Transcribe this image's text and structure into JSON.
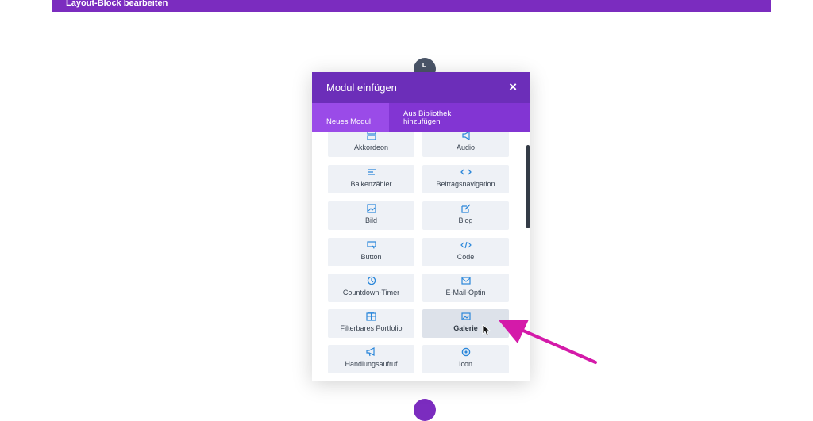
{
  "topbar": {
    "title": "Layout-Block bearbeiten"
  },
  "modal": {
    "title": "Modul einfügen",
    "close_symbol": "×",
    "tabs": {
      "new": "Neues Modul",
      "library_line1": "Aus Bibliothek",
      "library_line2": "hinzufügen"
    },
    "modules": [
      {
        "label": "Akkordeon",
        "icon": "accordion-icon"
      },
      {
        "label": "Audio",
        "icon": "audio-icon"
      },
      {
        "label": "Balkenzähler",
        "icon": "bar-counter-icon"
      },
      {
        "label": "Beitragsnavigation",
        "icon": "post-navigation-icon"
      },
      {
        "label": "Bild",
        "icon": "image-icon"
      },
      {
        "label": "Blog",
        "icon": "blog-icon"
      },
      {
        "label": "Button",
        "icon": "button-icon"
      },
      {
        "label": "Code",
        "icon": "code-icon"
      },
      {
        "label": "Countdown-Timer",
        "icon": "timer-icon"
      },
      {
        "label": "E-Mail-Optin",
        "icon": "email-icon"
      },
      {
        "label": "Filterbares Portfolio",
        "icon": "portfolio-icon"
      },
      {
        "label": "Galerie",
        "icon": "gallery-icon"
      },
      {
        "label": "Handlungsaufruf",
        "icon": "megaphone-icon"
      },
      {
        "label": "Icon",
        "icon": "circle-icon"
      }
    ],
    "active_module": "Galerie"
  },
  "colors": {
    "purple_dark": "#6c2eb9",
    "purple_tab": "#8235d3",
    "icon_blue": "#2b87da",
    "arrow_magenta": "#d41aa9"
  }
}
